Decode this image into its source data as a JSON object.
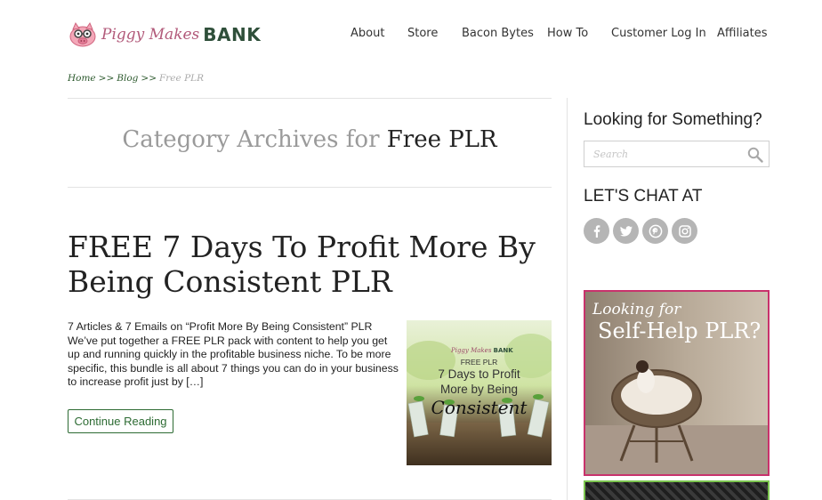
{
  "header": {
    "logo": {
      "script_text": "Piggy Makes",
      "bank_text": "BANK"
    },
    "nav": [
      {
        "label": "About"
      },
      {
        "label": "Store"
      },
      {
        "label": "Bacon Bytes"
      },
      {
        "label": "How To"
      },
      {
        "label": "Customer Log In"
      },
      {
        "label": "Affiliates"
      }
    ]
  },
  "breadcrumb": {
    "items": [
      "Home",
      "Blog"
    ],
    "separator": ">>",
    "current": "Free PLR"
  },
  "archive": {
    "prefix": "Category Archives for",
    "category": "Free PLR"
  },
  "post": {
    "title": "FREE 7 Days To Profit More By Being Consistent PLR",
    "excerpt": "7 Articles & 7 Emails on “Profit More By Being Consistent” PLR We’ve put together a FREE PLR pack with  content to help you get up and running quickly in the profitable business niche. To be more specific, this bundle is all about 7 things you can do in your business to increase profit just by […]",
    "button": "Continue Reading",
    "thumbnail": {
      "logo_script": "Piggy Makes",
      "logo_bank": "BANK",
      "label": "FREE PLR",
      "line1": "7 Days to Profit",
      "line2": "More by Being",
      "line3": "Consistent"
    }
  },
  "sidebar": {
    "search_heading": "Looking for Something?",
    "search_placeholder": "Search",
    "social_heading": "LET'S CHAT AT",
    "social_icons": [
      "facebook-icon",
      "twitter-icon",
      "pinterest-icon",
      "instagram-icon"
    ],
    "ad1": {
      "line1": "Looking for",
      "line2": "Self-Help PLR?"
    }
  },
  "colors": {
    "link_green": "#2d5a2e",
    "button_green": "#2d6b33",
    "ad_border_pink": "#c8326c",
    "ad_border_green": "#7cc54f",
    "social_grey": "#b5b5b5"
  }
}
